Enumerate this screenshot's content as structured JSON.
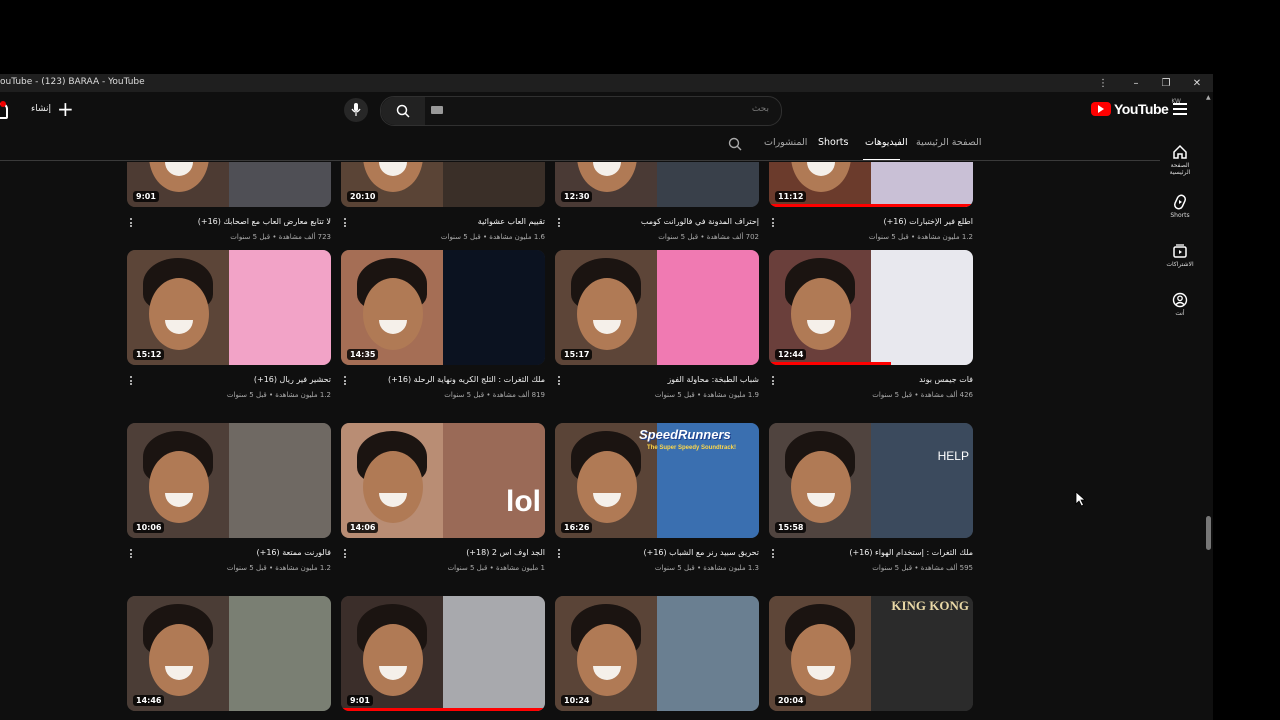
{
  "window": {
    "title": "ouTube - (123) BARAA - YouTube",
    "controls": {
      "more": "⋮",
      "minimize": "–",
      "restore": "❐",
      "close": "✕"
    }
  },
  "header": {
    "create_label": "إنشاء",
    "search_placeholder": "بحث",
    "logo_text": "YouTube",
    "logo_region": "KW"
  },
  "tabs": [
    {
      "label": "الصفحة الرئيسية",
      "active": false
    },
    {
      "label": "الفيديوهات",
      "active": true
    },
    {
      "label": "Shorts",
      "active": false
    },
    {
      "label": "المنشورات",
      "active": false
    }
  ],
  "guide": [
    {
      "label": "الصفحة الرئيسية",
      "icon": "home-icon"
    },
    {
      "label": "Shorts",
      "icon": "shorts-icon"
    },
    {
      "label": "الاشتراكات",
      "icon": "subscriptions-icon"
    },
    {
      "label": "أنت",
      "icon": "you-icon"
    }
  ],
  "videos": [
    {
      "title": "اطلع فير الإختبارات (16+)",
      "meta": "1.2 مليون مشاهدة • قبل 5 سنوات",
      "duration": "11:12",
      "progress": 1.0
    },
    {
      "title": "إحتراف المدونة في فالورانت كومب",
      "meta": "702 ألف مشاهدة • قبل 5 سنوات",
      "duration": "12:30",
      "progress": 0
    },
    {
      "title": "تقييم العاب عشوائية",
      "meta": "1.6 مليون مشاهدة • قبل 5 سنوات",
      "duration": "20:10",
      "progress": 0
    },
    {
      "title": "لا تتابع معارض العاب مع اصحابك (16+)",
      "meta": "723 ألف مشاهدة • قبل 5 سنوات",
      "duration": "9:01",
      "progress": 0
    },
    {
      "title": "فات جيمس بوند",
      "meta": "426 ألف مشاهدة • قبل 5 سنوات",
      "duration": "12:44",
      "progress": 0.6
    },
    {
      "title": "شباب الطبخة: محاولة الفوز",
      "meta": "1.9 مليون مشاهدة • قبل 5 سنوات",
      "duration": "15:17",
      "progress": 0
    },
    {
      "title": "ملك الثغرات : الثلج الكريه ونهاية الرحلة (16+)",
      "meta": "819 ألف مشاهدة • قبل 5 سنوات",
      "duration": "14:35",
      "progress": 0
    },
    {
      "title": "تحشير فير ريال (16+)",
      "meta": "1.2 مليون مشاهدة • قبل 5 سنوات",
      "duration": "15:12",
      "progress": 0
    },
    {
      "title": "ملك الثغرات : إستخدام الهواء (16+)",
      "meta": "595 ألف مشاهدة • قبل 5 سنوات",
      "duration": "15:58",
      "progress": 0
    },
    {
      "title": "تحريق سبيد رنر مع الشباب (16+)",
      "meta": "1.3 مليون مشاهدة • قبل 5 سنوات",
      "duration": "16:26",
      "progress": 0
    },
    {
      "title": "الجد اوف اس 2 (18+)",
      "meta": "1 مليون مشاهدة • قبل 5 سنوات",
      "duration": "14:06",
      "progress": 0
    },
    {
      "title": "فالورنت ممتعة (16+)",
      "meta": "1.2 مليون مشاهدة • قبل 5 سنوات",
      "duration": "10:06",
      "progress": 0
    },
    {
      "title": "",
      "meta": "",
      "duration": "20:04",
      "progress": 0
    },
    {
      "title": "",
      "meta": "",
      "duration": "10:24",
      "progress": 0
    },
    {
      "title": "",
      "meta": "",
      "duration": "9:01",
      "progress": 1.0
    },
    {
      "title": "",
      "meta": "",
      "duration": "14:46",
      "progress": 0
    }
  ],
  "thumb_text": {
    "help": "HELP",
    "lol": "lol",
    "speedrunners_line1": "SpeedRunners",
    "speedrunners_line2": "The Super Speedy Soundtrack!",
    "kingkong": "KING KONG"
  },
  "colors": {
    "background": "#0f0f0f",
    "accent": "#ff0000",
    "text": "#f1f1f1",
    "muted": "#aaaaaa"
  }
}
